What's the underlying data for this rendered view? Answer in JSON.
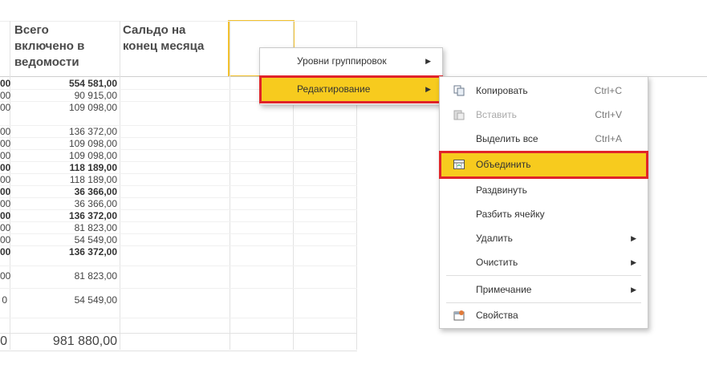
{
  "columns": {
    "total_included": "Всего включено в ведомости",
    "balance_end": "Сальдо на конец месяца"
  },
  "left_col_fragment": [
    "00",
    "00",
    "00",
    "00",
    "00",
    "00",
    "00",
    "00",
    "00",
    "00",
    "00",
    "00",
    "00",
    "00",
    "00",
    "0"
  ],
  "values": [
    {
      "v": "554 581,00",
      "bold": true
    },
    {
      "v": "90 915,00",
      "bold": false
    },
    {
      "v": "109 098,00",
      "bold": false
    },
    {
      "v": "136 372,00",
      "bold": false
    },
    {
      "v": "109 098,00",
      "bold": false
    },
    {
      "v": "109 098,00",
      "bold": false
    },
    {
      "v": "118 189,00",
      "bold": true
    },
    {
      "v": "118 189,00",
      "bold": false
    },
    {
      "v": "36 366,00",
      "bold": true
    },
    {
      "v": "36 366,00",
      "bold": false
    },
    {
      "v": "136 372,00",
      "bold": true
    },
    {
      "v": "81 823,00",
      "bold": false
    },
    {
      "v": "54 549,00",
      "bold": false
    },
    {
      "v": "136 372,00",
      "bold": true
    },
    {
      "v": "81 823,00",
      "bold": false
    },
    {
      "v": "54 549,00",
      "bold": false
    }
  ],
  "total": "981 880,00",
  "context_menu": {
    "items": [
      {
        "label": "Уровни группировок",
        "submenu": true
      },
      {
        "label": "Редактирование",
        "submenu": true,
        "highlighted": true
      }
    ]
  },
  "submenu": {
    "items": [
      {
        "label": "Копировать",
        "shortcut": "Ctrl+C",
        "icon": "copy-icon"
      },
      {
        "label": "Вставить",
        "shortcut": "Ctrl+V",
        "icon": "paste-icon",
        "disabled": true
      },
      {
        "label": "Выделить все",
        "shortcut": "Ctrl+A"
      },
      {
        "label": "Объединить",
        "icon": "merge-cells-icon",
        "highlighted": true
      },
      {
        "label": "Раздвинуть"
      },
      {
        "label": "Разбить ячейку"
      },
      {
        "label": "Удалить",
        "submenu": true
      },
      {
        "label": "Очистить",
        "submenu": true
      },
      {
        "label": "Примечание",
        "submenu": true
      },
      {
        "label": "Свойства",
        "icon": "properties-icon"
      }
    ]
  },
  "colors": {
    "highlight": "#f7cb1e",
    "highlight_border": "#e0242a",
    "selected_cell_border": "#f2c12e"
  }
}
